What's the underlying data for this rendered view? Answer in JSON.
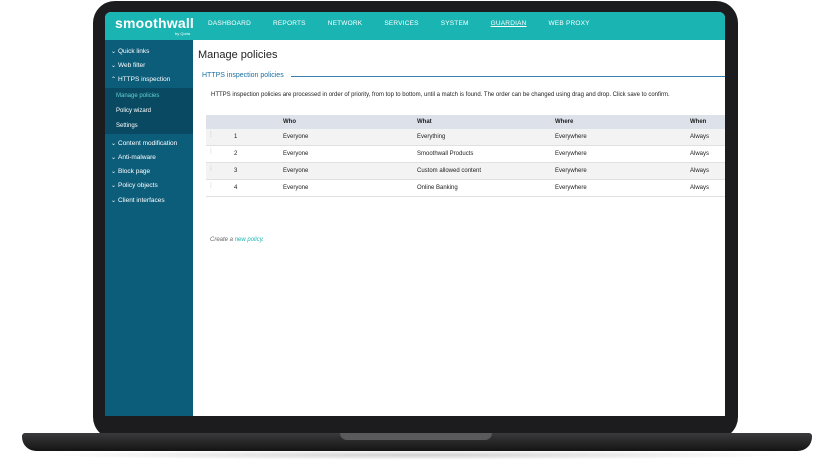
{
  "app": {
    "brand": "smoothwall",
    "brand_sub": "by Qoria"
  },
  "nav": {
    "items": [
      {
        "label": "DASHBOARD"
      },
      {
        "label": "REPORTS"
      },
      {
        "label": "NETWORK"
      },
      {
        "label": "SERVICES"
      },
      {
        "label": "SYSTEM"
      },
      {
        "label": "GUARDIAN",
        "active": true
      },
      {
        "label": "WEB PROXY"
      }
    ]
  },
  "sidebar": {
    "items": [
      {
        "label": "Quick links",
        "expanded": false
      },
      {
        "label": "Web filter",
        "expanded": false
      },
      {
        "label": "HTTPS inspection",
        "expanded": true
      },
      {
        "label": "Content modification",
        "expanded": false
      },
      {
        "label": "Anti-malware",
        "expanded": false
      },
      {
        "label": "Block page",
        "expanded": false
      },
      {
        "label": "Policy objects",
        "expanded": false
      },
      {
        "label": "Client interfaces",
        "expanded": false
      }
    ],
    "subitems": [
      {
        "label": "Manage policies",
        "active": true
      },
      {
        "label": "Policy wizard"
      },
      {
        "label": "Settings"
      }
    ]
  },
  "page": {
    "title": "Manage policies",
    "section_title": "HTTPS inspection policies",
    "description": "HTTPS inspection policies are processed in order of priority, from top to bottom, until a match is found. The order can be changed using drag and drop. Click save to confirm.",
    "create_prefix": "Create a ",
    "create_link": "new policy."
  },
  "table": {
    "headers": {
      "who": "Who",
      "what": "What",
      "where": "Where",
      "when": "When"
    },
    "rows": [
      {
        "num": "1",
        "who": "Everyone",
        "what": "Everything",
        "where": "Everywhere",
        "when": "Always"
      },
      {
        "num": "2",
        "who": "Everyone",
        "what": "Smoothwall Products",
        "where": "Everywhere",
        "when": "Always"
      },
      {
        "num": "3",
        "who": "Everyone",
        "what": "Custom allowed content",
        "where": "Everywhere",
        "when": "Always"
      },
      {
        "num": "4",
        "who": "Everyone",
        "what": "Online Banking",
        "where": "Everywhere",
        "when": "Always"
      }
    ]
  },
  "colors": {
    "topbar": "#1ab5b3",
    "sidebar": "#0c5d7a",
    "sidebar_sub": "#094a62",
    "accent": "#1ab5b3",
    "section_title": "#1a6fa0"
  }
}
